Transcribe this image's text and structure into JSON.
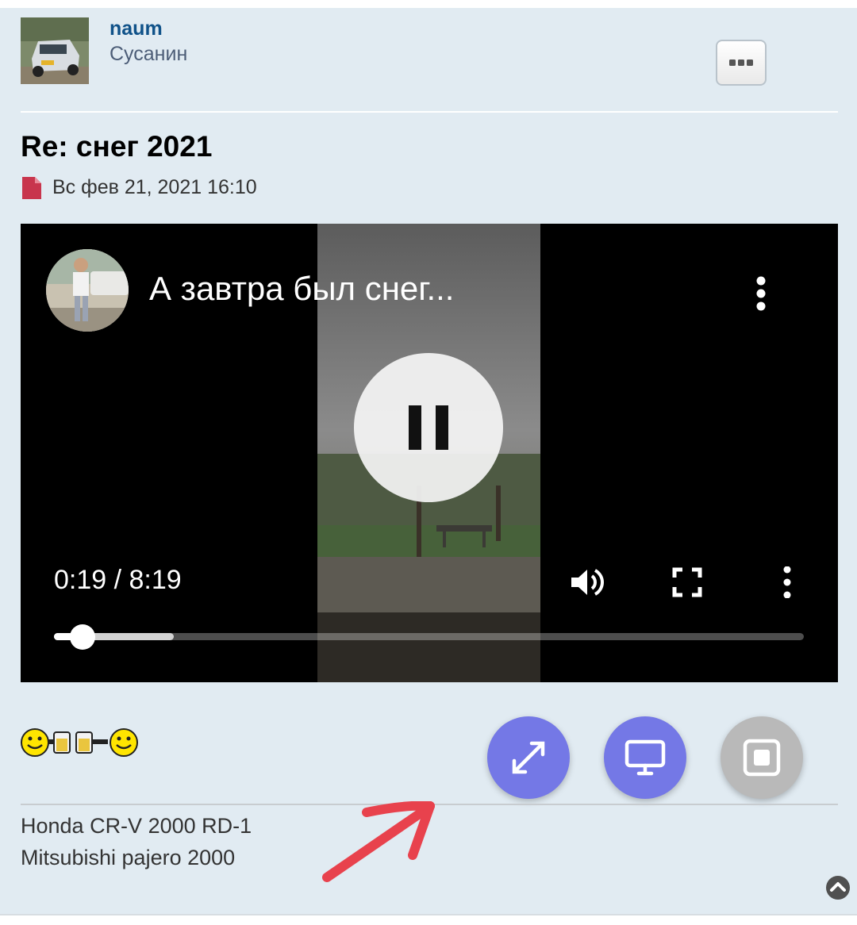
{
  "post": {
    "author": "naum",
    "rank": "Сусанин",
    "title": "Re: снег 2021",
    "date": "Вс фев 21, 2021 16:10"
  },
  "video": {
    "title": "А завтра был снег...",
    "time_display": "0:19 / 8:19",
    "progress": 0.0385,
    "buffered": 0.16
  },
  "signature": {
    "line1": "Honda CR-V 2000 RD-1",
    "line2": "Mitsubishi pajero 2000"
  },
  "colors": {
    "fab_accent": "#7478e6",
    "fab_disabled": "#b9b9b9",
    "annotation_arrow": "#e8424d",
    "username_link": "#105289",
    "post_bg": "#e1ebf2"
  },
  "icons": [
    "more-icon",
    "file-icon",
    "video-menu-icon",
    "pause-icon",
    "volume-icon",
    "fullscreen-icon",
    "expand-icon",
    "monitor-icon",
    "stop-icon",
    "scroll-top-icon"
  ]
}
